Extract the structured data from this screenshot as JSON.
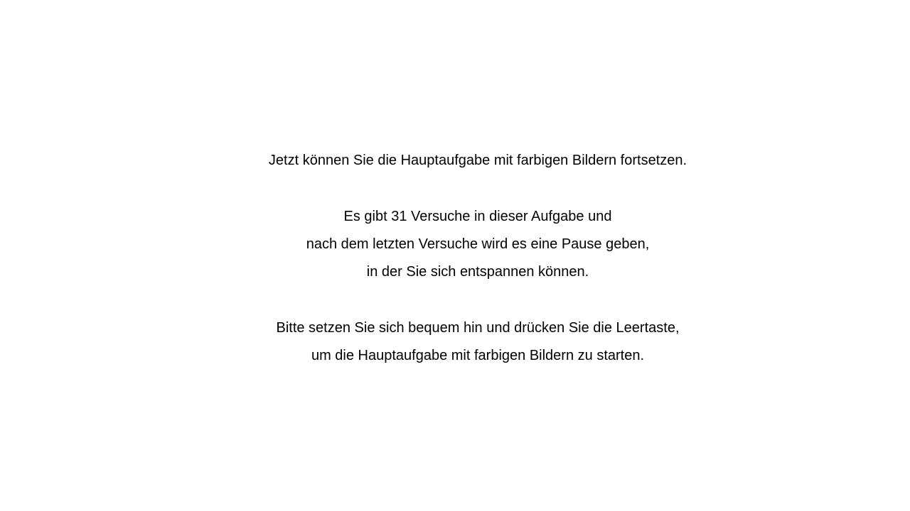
{
  "instructions": {
    "intro": "Jetzt können Sie die Hauptaufgabe mit farbigen Bildern fortsetzen.",
    "trials_line_1": "Es gibt 31 Versuche in dieser Aufgabe und",
    "trials_line_2": "nach dem letzten Versuche wird es eine Pause geben,",
    "trials_line_3": "in der Sie sich entspannen können.",
    "start_line_1": "Bitte setzen Sie sich bequem hin und drücken Sie die Leertaste,",
    "start_line_2": "um die Hauptaufgabe mit farbigen Bildern zu starten."
  },
  "colors": {
    "background": "#ffffff",
    "text": "#000000"
  }
}
